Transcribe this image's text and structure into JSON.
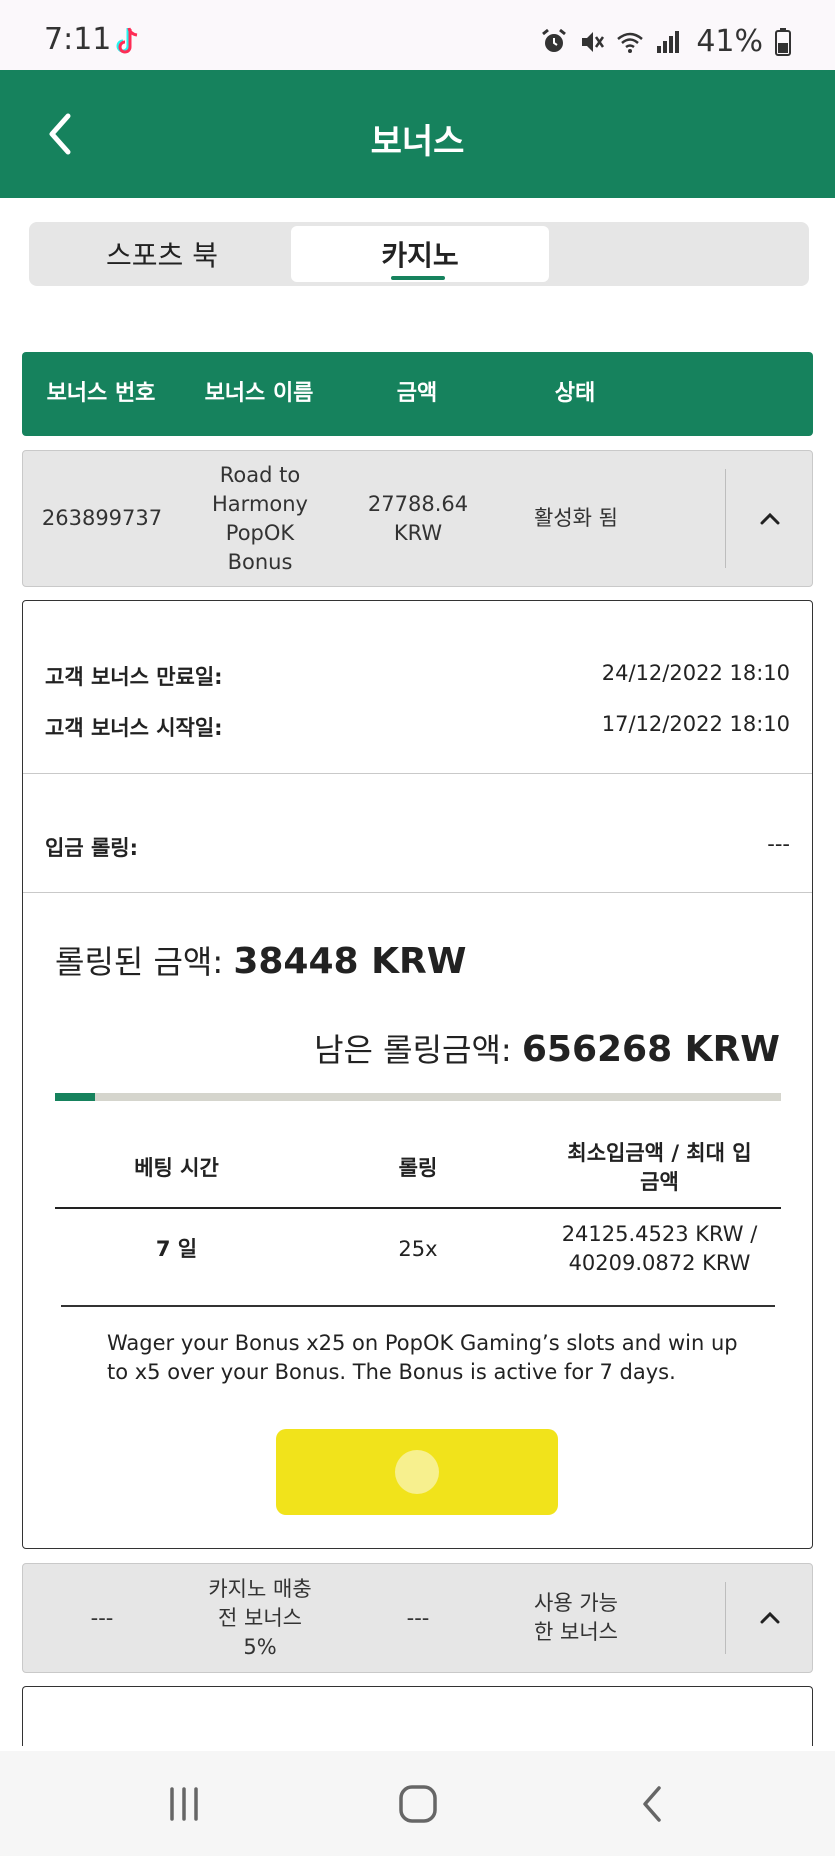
{
  "status_bar": {
    "time": "7:11",
    "battery": "41%"
  },
  "header": {
    "title": "보너스"
  },
  "tabs": [
    {
      "label": "스포츠 북",
      "active": false
    },
    {
      "label": "카지노",
      "active": true
    }
  ],
  "table": {
    "columns": [
      "보너스 번호",
      "보너스 이름",
      "금액",
      "상태"
    ]
  },
  "bonuses": [
    {
      "number": "263899737",
      "name": "Road to Harmony PopOK Bonus",
      "amount": "27788.64 KRW",
      "status": "활성화 됨"
    },
    {
      "number": "---",
      "name": "카지노 매충 전 보너스 5%",
      "amount": "---",
      "status": "사용 가능한 보너스"
    }
  ],
  "details": {
    "expiry_label": "고객 보너스 만료일:",
    "expiry_value": "24/12/2022 18:10",
    "start_label": "고객 보너스 시작일:",
    "start_value": "17/12/2022 18:10",
    "deposit_rolling_label": "입금 롤링:",
    "deposit_rolling_value": "---",
    "rolled_label": "롤링된 금액:",
    "rolled_value": "38448 KRW",
    "remaining_label": "남은 롤링금액:",
    "remaining_value": "656268 KRW",
    "progress_fraction": 0.055,
    "wager_table": {
      "headers": [
        "베팅 시간",
        "롤링",
        "최소입금액 / 최대 입금액"
      ],
      "row": [
        "7 일",
        "25x",
        "24125.4523 KRW / 40209.0872 KRW"
      ]
    },
    "description": "Wager your Bonus x25 on PopOK Gaming’s slots and win up to x5 over your Bonus. The Bonus is active for 7 days."
  },
  "colors": {
    "brand_green": "#16825d",
    "button_yellow": "#f1e31b",
    "row_grey": "#e6e6e6"
  }
}
